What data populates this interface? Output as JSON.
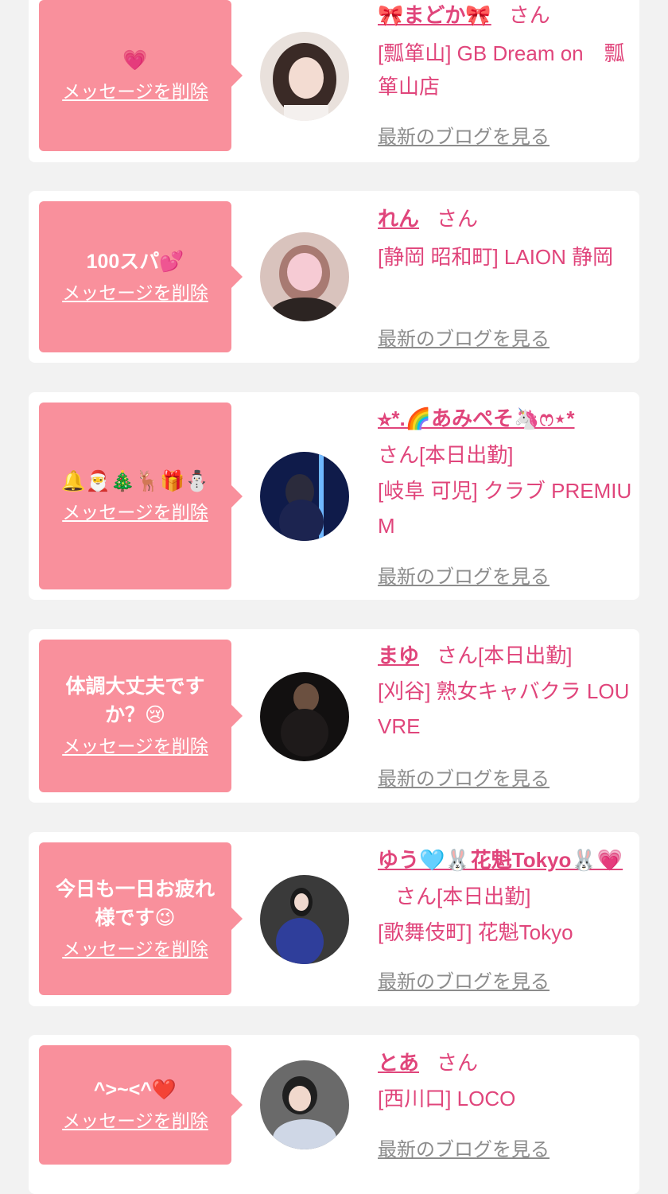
{
  "common": {
    "delete_label": "メッセージを削除",
    "blog_label": "最新のブログを見る",
    "honorific": "さん"
  },
  "entries": [
    {
      "message": "💗",
      "name": "🎀まどか🎀",
      "suffix": "さん",
      "status": "",
      "shop": "[瓢箪山] GB Dream on　瓢箪山店"
    },
    {
      "message": "100スパ💕",
      "name": "れん",
      "suffix": "さん",
      "status": "",
      "shop": "[静岡 昭和町] LAION 静岡"
    },
    {
      "message": "🔔🎅🎄🦌🎁⛄",
      "name": "⭐︎*.🌈あみぺそ🦄ෆ⋆*",
      "suffix": "さん",
      "status": "[本日出勤]",
      "shop": "[岐阜 可児] クラブ PREMIUM"
    },
    {
      "message": "体調大丈夫ですか？😢",
      "name": "まゆ",
      "suffix": "さん",
      "status": "[本日出勤]",
      "shop": "[刈谷] 熟女キャバクラ LOUVRE"
    },
    {
      "message": "今日も一日お疲れ様です😉",
      "name": "ゆう🩵🐰花魁Tokyo🐰💗",
      "suffix": "さん",
      "status": "[本日出勤]",
      "shop": "[歌舞伎町] 花魁Tokyo"
    },
    {
      "message": "^>~<^❤️",
      "name": "とあ",
      "suffix": "さん",
      "status": "",
      "shop": "[西川口] LOCO"
    }
  ],
  "colors": {
    "background": "#f2f2f2",
    "bubble": "#f9909c",
    "accent": "#e0457b",
    "muted": "#8c8c8c"
  }
}
